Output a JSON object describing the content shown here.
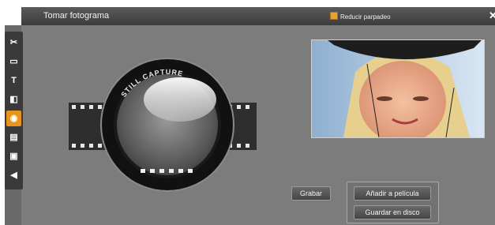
{
  "window": {
    "title": "Tomar fotograma",
    "flicker_label": "Reducir parpadeo",
    "close_glyph": "✕"
  },
  "toolbar": {
    "items": [
      {
        "icon": "scissors-icon",
        "glyph": "✂",
        "active": false
      },
      {
        "icon": "image-icon",
        "glyph": "▭",
        "active": false
      },
      {
        "icon": "text-icon",
        "glyph": "T",
        "active": false
      },
      {
        "icon": "effects-icon",
        "glyph": "◧",
        "active": false
      },
      {
        "icon": "camera-icon",
        "glyph": "◉",
        "active": true
      },
      {
        "icon": "clapper-icon",
        "glyph": "▤",
        "active": false
      },
      {
        "icon": "disc-icon",
        "glyph": "▣",
        "active": false
      },
      {
        "icon": "speaker-icon",
        "glyph": "◀",
        "active": false
      }
    ]
  },
  "capture": {
    "lens_text": "STILL CAPTURE"
  },
  "buttons": {
    "record": "Grabar",
    "add_to_movie": "Añadir a película",
    "save_to_disk": "Guardar en disco"
  },
  "colors": {
    "accent": "#e9941c",
    "panel": "#7c7c7c",
    "titlebar": "#3c3c3c"
  }
}
